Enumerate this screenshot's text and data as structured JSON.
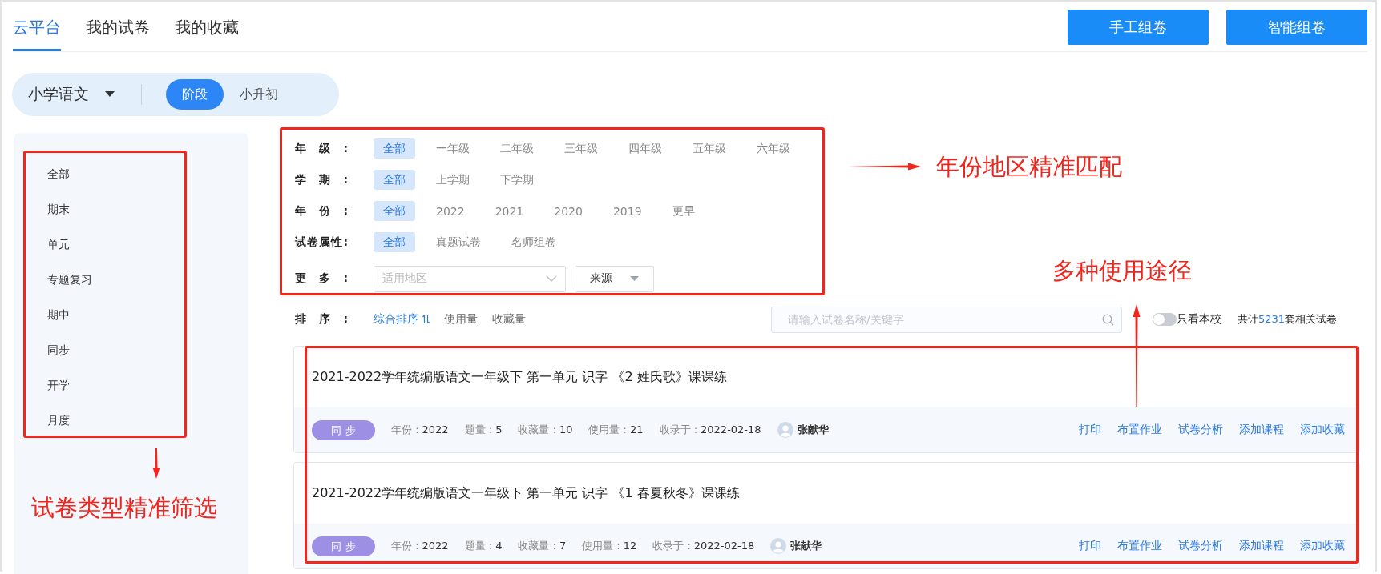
{
  "tabs": [
    {
      "label": "云平台",
      "selected": true
    },
    {
      "label": "我的试卷",
      "selected": false
    },
    {
      "label": "我的收藏",
      "selected": false
    }
  ],
  "actions": [
    "手工组卷",
    "智能组卷"
  ],
  "subject": {
    "label": "小学语文",
    "modes": [
      {
        "label": "阶段",
        "selected": true
      },
      {
        "label": "小升初",
        "selected": false
      }
    ]
  },
  "sidebar": {
    "items": [
      "全部",
      "期末",
      "单元",
      "专题复习",
      "期中",
      "同步",
      "开学",
      "月度"
    ]
  },
  "filters": [
    {
      "kind": "options",
      "label": "年级:",
      "options": [
        {
          "label": "全部",
          "selected": true
        },
        {
          "label": "一年级",
          "selected": false
        },
        {
          "label": "二年级",
          "selected": false
        },
        {
          "label": "三年级",
          "selected": false
        },
        {
          "label": "四年级",
          "selected": false
        },
        {
          "label": "五年级",
          "selected": false
        },
        {
          "label": "六年级",
          "selected": false
        }
      ]
    },
    {
      "kind": "options",
      "label": "学期:",
      "options": [
        {
          "label": "全部",
          "selected": true
        },
        {
          "label": "上学期",
          "selected": false
        },
        {
          "label": "下学期",
          "selected": false
        }
      ]
    },
    {
      "kind": "options",
      "label": "年份:",
      "options": [
        {
          "label": "全部",
          "selected": true
        },
        {
          "label": "2022",
          "selected": false
        },
        {
          "label": "2021",
          "selected": false
        },
        {
          "label": "2020",
          "selected": false
        },
        {
          "label": "2019",
          "selected": false
        },
        {
          "label": "更早",
          "selected": false
        }
      ]
    },
    {
      "kind": "options",
      "label": "试卷属性:",
      "options": [
        {
          "label": "全部",
          "selected": true
        },
        {
          "label": "真题试卷",
          "selected": false
        },
        {
          "label": "名师组卷",
          "selected": false
        }
      ]
    },
    {
      "kind": "selects",
      "label": "更多:",
      "region": {
        "placeholder": "适用地区"
      },
      "source": {
        "value": "来源"
      }
    }
  ],
  "sort": {
    "label": "排序:",
    "options": [
      {
        "label": "综合排序",
        "selected": true
      },
      {
        "label": "使用量",
        "selected": false
      },
      {
        "label": "收藏量",
        "selected": false
      }
    ]
  },
  "search": {
    "placeholder": "请输入试卷名称/关键字"
  },
  "toggle": {
    "label": "只看本校",
    "on": false
  },
  "count": {
    "prefix": "共计",
    "number": "5231",
    "suffix": "套相关试卷"
  },
  "papers": [
    {
      "title": "2021-2022学年统编版语文一年级下 第一单元 识字 《2 姓氏歌》课课练",
      "tag": "同 步",
      "meta": [
        {
          "label": "年份 :",
          "value": "2022"
        },
        {
          "label": "题量 :",
          "value": "5"
        },
        {
          "label": "收藏量 :",
          "value": "10"
        },
        {
          "label": "使用量 :",
          "value": "21"
        },
        {
          "label": "收录于 :",
          "value": "2022-02-18"
        }
      ],
      "author": "张献华",
      "actions": [
        "打印",
        "布置作业",
        "试卷分析",
        "添加课程",
        "添加收藏"
      ]
    },
    {
      "title": "2021-2022学年统编版语文一年级下 第一单元 识字 《1 春夏秋冬》课课练",
      "tag": "同 步",
      "meta": [
        {
          "label": "年份 :",
          "value": "2022"
        },
        {
          "label": "题量 :",
          "value": "4"
        },
        {
          "label": "收藏量 :",
          "value": "7"
        },
        {
          "label": "使用量 :",
          "value": "12"
        },
        {
          "label": "收录于 :",
          "value": "2022-02-18"
        }
      ],
      "author": "张献华",
      "actions": [
        "打印",
        "布置作业",
        "试卷分析",
        "添加课程",
        "添加收藏"
      ]
    }
  ],
  "annotations": [
    "年份地区精准匹配",
    "多种使用途径",
    "试卷类型精准筛选"
  ]
}
